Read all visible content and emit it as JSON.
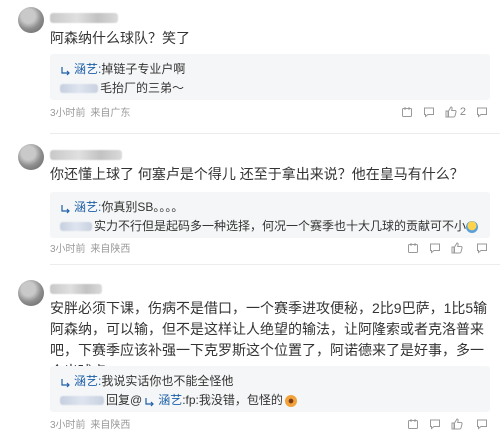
{
  "comments": [
    {
      "text": "阿森纳什么球队？笑了",
      "replies": [
        {
          "name": "涵艺:",
          "text": "掉链子专业户啊"
        },
        {
          "name": "",
          "text": "毛抬厂的三弟～"
        }
      ],
      "time": "3小时前",
      "location": "来自广东",
      "likes": "2"
    },
    {
      "text": "你还懂上球了 何塞卢是个得儿 还至于拿出来说？他在皇马有什么？",
      "replies": [
        {
          "name": "涵艺:",
          "text": "你真别SB。。。。"
        },
        {
          "name": "",
          "text": "实力不行但是起码多一种选择，何况一个赛季也十大几球的贡献可不小"
        }
      ],
      "time": "3小时前",
      "location": "来自陕西",
      "likes": ""
    },
    {
      "text": "安胖必须下课，伤病不是借口，一个赛季进攻便秘，2比9巴萨，1比5输阿森纳，可以输，但不是这样让人绝望的输法，让阿隆索或者克洛普来吧，下赛季应该补强一下克罗斯这个位置了，阿诺德来了是好事，多一个出球点",
      "replies": [
        {
          "name": "涵艺:",
          "text": "我说实话你也不能全怪他"
        },
        {
          "prefix": "回复@",
          "name": "涵艺",
          "text": ":fp:我没错，包怪的"
        }
      ],
      "time": "3小时前",
      "location": "来自陕西",
      "likes": ""
    }
  ],
  "colors": {
    "link": "#1c5fa8",
    "meta": "#9a9a9a",
    "reply_bg": "#f5f6f7"
  }
}
